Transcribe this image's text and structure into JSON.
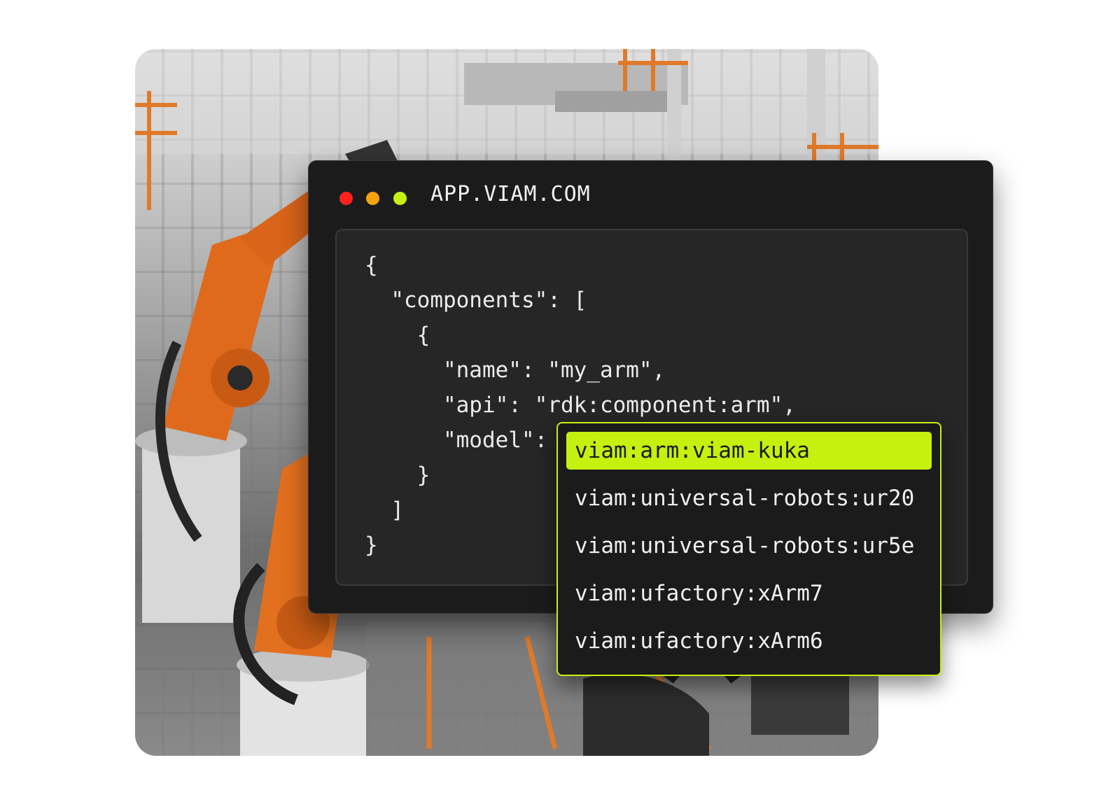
{
  "window": {
    "title": "APP.VIAM.COM",
    "dots": [
      {
        "name": "close",
        "color": "#ff2020"
      },
      {
        "name": "minimize",
        "color": "#f5a30c"
      },
      {
        "name": "maximize",
        "color": "#c6f00f"
      }
    ]
  },
  "code": {
    "lines": [
      "{",
      "  \"components\": [",
      "    {",
      "      \"name\": \"my_arm\",",
      "      \"api\": \"rdk:component:arm\",",
      "      \"model\": ",
      "    }",
      "  ]",
      "}"
    ]
  },
  "dropdown": {
    "accent_color": "#c6f00f",
    "selected_index": 0,
    "options": [
      "viam:arm:viam-kuka",
      "viam:universal-robots:ur20",
      "viam:universal-robots:ur5e",
      "viam:ufactory:xArm7",
      "viam:ufactory:xArm6"
    ]
  }
}
